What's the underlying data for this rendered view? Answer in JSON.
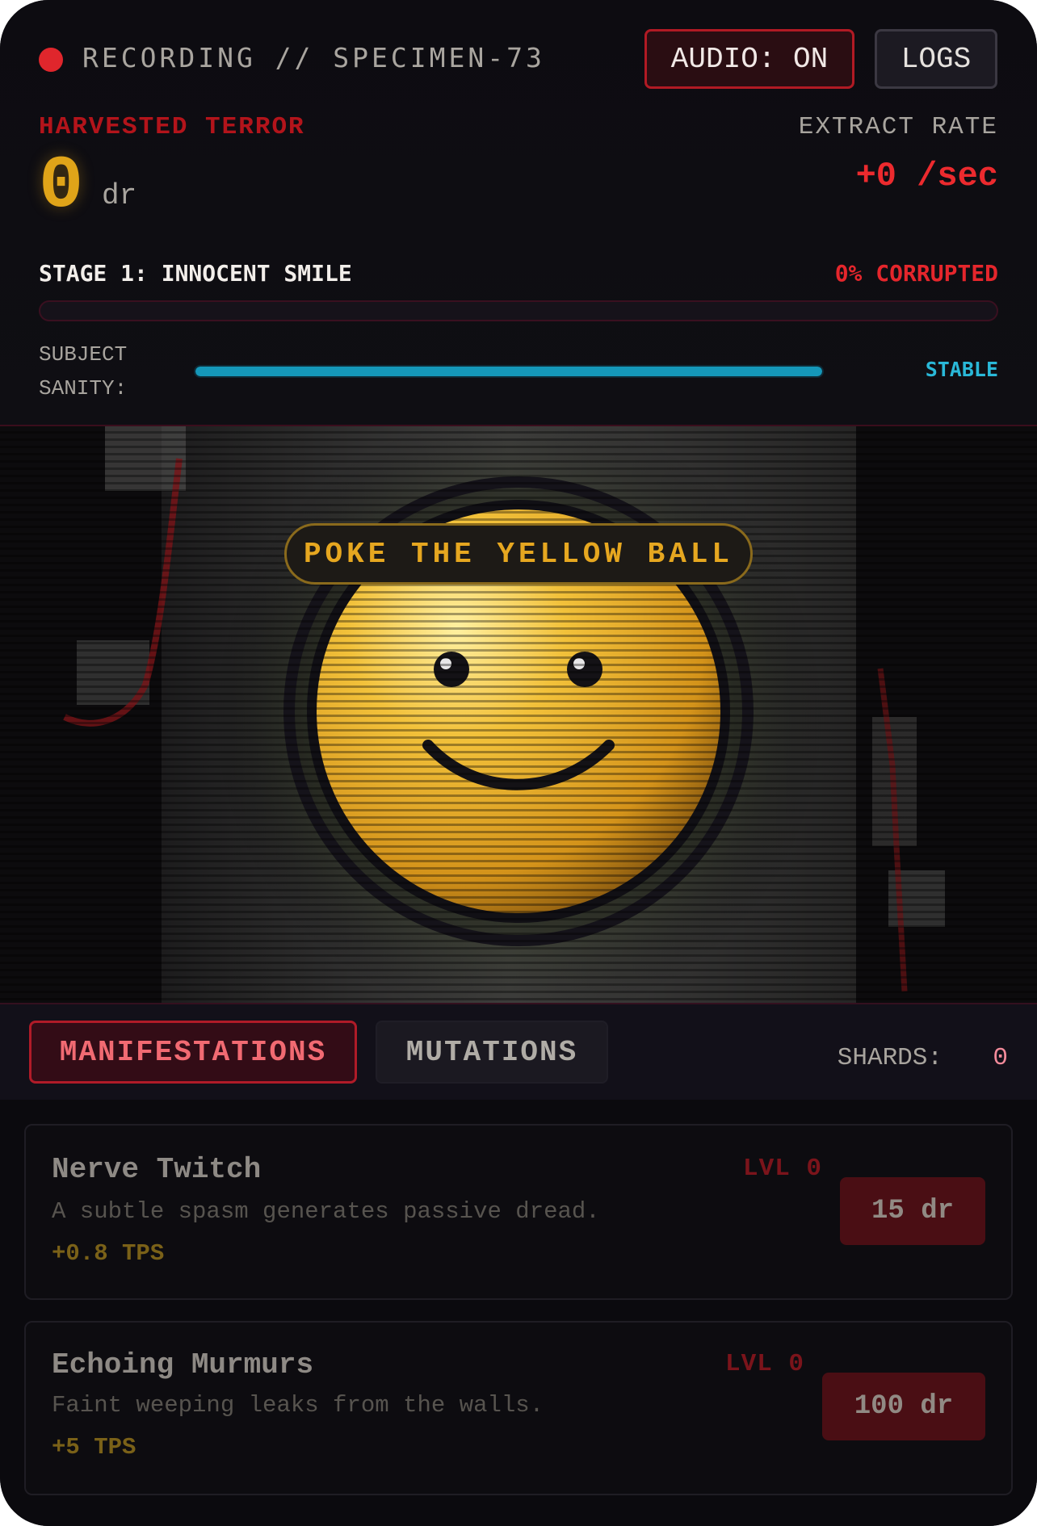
{
  "header": {
    "recording_label": "RECORDING // SPECIMEN-73",
    "audio_button": "AUDIO: ON",
    "logs_button": "LOGS"
  },
  "terror": {
    "label": "HARVESTED TERROR",
    "value": "0",
    "unit": "dr"
  },
  "extract": {
    "label": "EXTRACT RATE",
    "value": "+0 /sec"
  },
  "stage": {
    "title": "STAGE 1: INNOCENT SMILE",
    "corruption_text": "0% CORRUPTED",
    "corruption_fraction": 0
  },
  "sanity": {
    "label": "SUBJECT SANITY:",
    "status": "STABLE",
    "level_fraction": 1.0
  },
  "scene": {
    "poke_prompt": "POKE THE YELLOW BALL"
  },
  "tabs": [
    {
      "label": "MANIFESTATIONS",
      "active": true
    },
    {
      "label": "MUTATIONS",
      "active": false
    }
  ],
  "shards": {
    "label": "SHARDS:",
    "value": "0"
  },
  "upgrades": [
    {
      "name": "Nerve Twitch",
      "desc": "A subtle spasm generates passive dread.",
      "tps": "+0.8 TPS",
      "level": "LVL 0",
      "cost": "15 dr"
    },
    {
      "name": "Echoing Murmurs",
      "desc": "Faint weeping leaks from the walls.",
      "tps": "+5 TPS",
      "level": "LVL 0",
      "cost": "100 dr"
    }
  ],
  "colors": {
    "accent_red": "#e5262c",
    "gold": "#e0a419",
    "sanity_cyan": "#1597b9",
    "background": "#0b0a0e"
  },
  "icons": [
    "recording-dot-icon",
    "smiley-ball-icon"
  ]
}
